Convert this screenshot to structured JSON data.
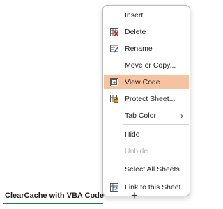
{
  "context_menu": {
    "items": [
      {
        "label": "Insert...",
        "icon": "",
        "disabled": false
      },
      {
        "label": "Delete",
        "icon": "delete-sheet-icon",
        "disabled": false
      },
      {
        "label": "Rename",
        "icon": "rename-icon",
        "disabled": false
      },
      {
        "label": "Move or Copy...",
        "icon": "",
        "disabled": false
      },
      {
        "label": "View Code",
        "icon": "view-code-icon",
        "disabled": false,
        "highlighted": true
      },
      {
        "label": "Protect Sheet...",
        "icon": "protect-sheet-icon",
        "disabled": false
      },
      {
        "label": "Tab Color",
        "icon": "",
        "disabled": false,
        "submenu": true
      },
      {
        "label": "Hide",
        "icon": "",
        "disabled": false
      },
      {
        "label": "Unhide...",
        "icon": "",
        "disabled": true
      },
      {
        "label": "Select All Sheets",
        "icon": "",
        "disabled": false
      },
      {
        "label": "Link to this Sheet",
        "icon": "link-sheet-icon",
        "disabled": false
      }
    ],
    "highlight_color": "#f6c29f"
  },
  "sheet_tabs": {
    "active_tab": "ClearCache with VBA Code",
    "add_sheet": "+",
    "accent_color": "#1f7a3f"
  }
}
